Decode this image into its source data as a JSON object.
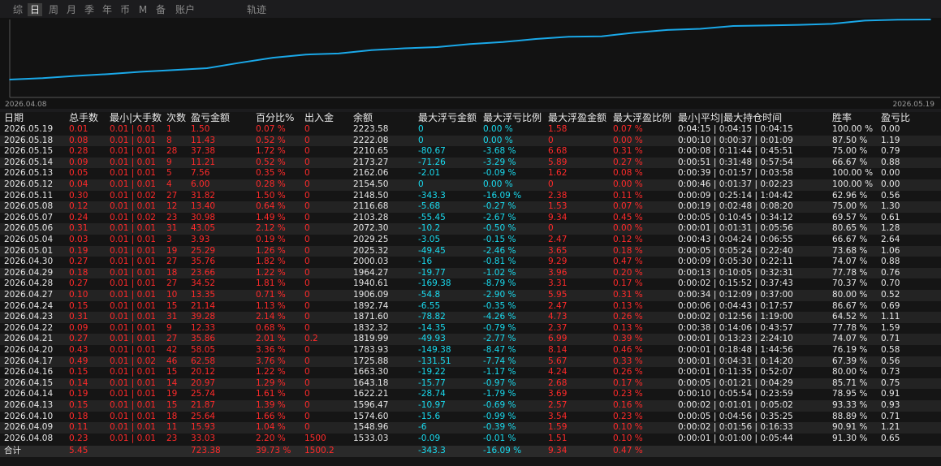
{
  "tabs": [
    {
      "label": "综",
      "active": false
    },
    {
      "label": "日",
      "active": true
    },
    {
      "label": "周",
      "active": false
    },
    {
      "label": "月",
      "active": false
    },
    {
      "label": "季",
      "active": false
    },
    {
      "label": "年",
      "active": false
    },
    {
      "label": "币",
      "active": false
    },
    {
      "label": "M",
      "active": false
    },
    {
      "label": "备",
      "active": false
    },
    {
      "label": "账户",
      "active": false
    },
    {
      "label": "轨迹",
      "active": false
    }
  ],
  "chart_data": {
    "type": "line",
    "x": [
      "2026.04.08",
      "2026.04.09",
      "2026.04.10",
      "2026.04.13",
      "2026.04.14",
      "2026.04.15",
      "2026.04.16",
      "2026.04.17",
      "2026.04.20",
      "2026.04.21",
      "2026.04.22",
      "2026.04.23",
      "2026.04.24",
      "2026.04.27",
      "2026.04.28",
      "2026.04.29",
      "2026.04.30",
      "2026.05.01",
      "2026.05.04",
      "2026.05.06",
      "2026.05.07",
      "2026.05.08",
      "2026.05.11",
      "2026.05.12",
      "2026.05.13",
      "2026.05.14",
      "2026.05.15",
      "2026.05.18",
      "2026.05.19"
    ],
    "series": [
      {
        "values": [
          1533.03,
          1548.96,
          1574.6,
          1596.47,
          1622.21,
          1643.18,
          1663.3,
          1725.88,
          1783.93,
          1819.99,
          1832.32,
          1871.6,
          1892.74,
          1906.09,
          1940.61,
          1964.27,
          2000.03,
          2025.32,
          2029.25,
          2072.3,
          2103.28,
          2116.68,
          2148.5,
          2154.5,
          2162.06,
          2173.27,
          2210.65,
          2222.08,
          2223.58
        ]
      }
    ],
    "x_tick_labels": [
      "2026.04.08",
      "2026.05.19"
    ],
    "line_color": "#1aa8e8",
    "grid": false
  },
  "table": {
    "headers": [
      "日期",
      "总手数",
      "最小|大手数",
      "次数",
      "盈亏金额",
      "百分比%",
      "出入金",
      "余额",
      "最大浮亏金额",
      "最大浮亏比例",
      "最大浮盈金额",
      "最大浮盈比例",
      "最小|平均|最大持仓时间",
      "胜率",
      "盈亏比"
    ],
    "rows": [
      [
        "2026.05.19",
        "0.01",
        "0.01 | 0.01",
        "1",
        "1.50",
        "0.07 %",
        "0",
        "2223.58",
        "0",
        "0.00 %",
        "1.58",
        "0.07 %",
        "0:04:15 | 0:04:15 | 0:04:15",
        "100.00 %",
        "0.00"
      ],
      [
        "2026.05.18",
        "0.08",
        "0.01 | 0.01",
        "8",
        "11.43",
        "0.52 %",
        "0",
        "2222.08",
        "0",
        "0.00 %",
        "0",
        "0.00 %",
        "0:00:10 | 0:00:37 | 0:01:09",
        "87.50 %",
        "1.19"
      ],
      [
        "2026.05.15",
        "0.28",
        "0.01 | 0.01",
        "28",
        "37.38",
        "1.72 %",
        "0",
        "2210.65",
        "-80.67",
        "-3.68 %",
        "6.68",
        "0.31 %",
        "0:00:08 | 0:11:44 | 0:45:51",
        "75.00 %",
        "0.79"
      ],
      [
        "2026.05.14",
        "0.09",
        "0.01 | 0.01",
        "9",
        "11.21",
        "0.52 %",
        "0",
        "2173.27",
        "-71.26",
        "-3.29 %",
        "5.89",
        "0.27 %",
        "0:00:51 | 0:31:48 | 0:57:54",
        "66.67 %",
        "0.88"
      ],
      [
        "2026.05.13",
        "0.05",
        "0.01 | 0.01",
        "5",
        "7.56",
        "0.35 %",
        "0",
        "2162.06",
        "-2.01",
        "-0.09 %",
        "1.62",
        "0.08 %",
        "0:00:39 | 0:01:57 | 0:03:58",
        "100.00 %",
        "0.00"
      ],
      [
        "2026.05.12",
        "0.04",
        "0.01 | 0.01",
        "4",
        "6.00",
        "0.28 %",
        "0",
        "2154.50",
        "0",
        "0.00 %",
        "0",
        "0.00 %",
        "0:00:46 | 0:01:37 | 0:02:23",
        "100.00 %",
        "0.00"
      ],
      [
        "2026.05.11",
        "0.30",
        "0.01 | 0.02",
        "27",
        "31.82",
        "1.50 %",
        "0",
        "2148.50",
        "-343.3",
        "-16.09 %",
        "2.38",
        "0.11 %",
        "0:00:09 | 0:25:14 | 1:04:42",
        "62.96 %",
        "0.56"
      ],
      [
        "2026.05.08",
        "0.12",
        "0.01 | 0.01",
        "12",
        "13.40",
        "0.64 %",
        "0",
        "2116.68",
        "-5.68",
        "-0.27 %",
        "1.53",
        "0.07 %",
        "0:00:19 | 0:02:48 | 0:08:20",
        "75.00 %",
        "1.30"
      ],
      [
        "2026.05.07",
        "0.24",
        "0.01 | 0.02",
        "23",
        "30.98",
        "1.49 %",
        "0",
        "2103.28",
        "-55.45",
        "-2.67 %",
        "9.34",
        "0.45 %",
        "0:00:05 | 0:10:45 | 0:34:12",
        "69.57 %",
        "0.61"
      ],
      [
        "2026.05.06",
        "0.31",
        "0.01 | 0.01",
        "31",
        "43.05",
        "2.12 %",
        "0",
        "2072.30",
        "-10.2",
        "-0.50 %",
        "0",
        "0.00 %",
        "0:00:01 | 0:01:31 | 0:05:56",
        "80.65 %",
        "1.28"
      ],
      [
        "2026.05.04",
        "0.03",
        "0.01 | 0.01",
        "3",
        "3.93",
        "0.19 %",
        "0",
        "2029.25",
        "-3.05",
        "-0.15 %",
        "2.47",
        "0.12 %",
        "0:00:43 | 0:04:24 | 0:06:55",
        "66.67 %",
        "2.64"
      ],
      [
        "2026.05.01",
        "0.19",
        "0.01 | 0.01",
        "19",
        "25.29",
        "1.26 %",
        "0",
        "2025.32",
        "-49.45",
        "-2.46 %",
        "3.65",
        "0.18 %",
        "0:00:05 | 0:05:24 | 0:22:40",
        "73.68 %",
        "1.06"
      ],
      [
        "2026.04.30",
        "0.27",
        "0.01 | 0.01",
        "27",
        "35.76",
        "1.82 %",
        "0",
        "2000.03",
        "-16",
        "-0.81 %",
        "9.29",
        "0.47 %",
        "0:00:09 | 0:05:30 | 0:22:11",
        "74.07 %",
        "0.88"
      ],
      [
        "2026.04.29",
        "0.18",
        "0.01 | 0.01",
        "18",
        "23.66",
        "1.22 %",
        "0",
        "1964.27",
        "-19.77",
        "-1.02 %",
        "3.96",
        "0.20 %",
        "0:00:13 | 0:10:05 | 0:32:31",
        "77.78 %",
        "0.76"
      ],
      [
        "2026.04.28",
        "0.27",
        "0.01 | 0.01",
        "27",
        "34.52",
        "1.81 %",
        "0",
        "1940.61",
        "-169.38",
        "-8.79 %",
        "3.31",
        "0.17 %",
        "0:00:02 | 0:15:52 | 0:37:43",
        "70.37 %",
        "0.70"
      ],
      [
        "2026.04.27",
        "0.10",
        "0.01 | 0.01",
        "10",
        "13.35",
        "0.71 %",
        "0",
        "1906.09",
        "-54.8",
        "-2.90 %",
        "5.95",
        "0.31 %",
        "0:00:34 | 0:12:09 | 0:37:00",
        "80.00 %",
        "0.52"
      ],
      [
        "2026.04.24",
        "0.15",
        "0.01 | 0.01",
        "15",
        "21.14",
        "1.13 %",
        "0",
        "1892.74",
        "-6.55",
        "-0.35 %",
        "2.47",
        "0.13 %",
        "0:00:06 | 0:04:43 | 0:17:57",
        "86.67 %",
        "0.69"
      ],
      [
        "2026.04.23",
        "0.31",
        "0.01 | 0.01",
        "31",
        "39.28",
        "2.14 %",
        "0",
        "1871.60",
        "-78.82",
        "-4.26 %",
        "4.73",
        "0.26 %",
        "0:00:02 | 0:12:56 | 1:19:00",
        "64.52 %",
        "1.11"
      ],
      [
        "2026.04.22",
        "0.09",
        "0.01 | 0.01",
        "9",
        "12.33",
        "0.68 %",
        "0",
        "1832.32",
        "-14.35",
        "-0.79 %",
        "2.37",
        "0.13 %",
        "0:00:38 | 0:14:06 | 0:43:57",
        "77.78 %",
        "1.59"
      ],
      [
        "2026.04.21",
        "0.27",
        "0.01 | 0.01",
        "27",
        "35.86",
        "2.01 %",
        "0.2",
        "1819.99",
        "-49.93",
        "-2.77 %",
        "6.99",
        "0.39 %",
        "0:00:01 | 0:13:23 | 2:24:10",
        "74.07 %",
        "0.71"
      ],
      [
        "2026.04.20",
        "0.43",
        "0.01 | 0.01",
        "42",
        "58.05",
        "3.36 %",
        "0",
        "1783.93",
        "-149.38",
        "-8.47 %",
        "8.14",
        "0.46 %",
        "0:00:01 | 0:18:48 | 1:44:56",
        "76.19 %",
        "0.58"
      ],
      [
        "2026.04.17",
        "0.49",
        "0.01 | 0.02",
        "46",
        "62.58",
        "3.76 %",
        "0",
        "1725.88",
        "-131.51",
        "-7.74 %",
        "5.67",
        "0.33 %",
        "0:00:01 | 0:04:31 | 0:14:20",
        "67.39 %",
        "0.56"
      ],
      [
        "2026.04.16",
        "0.15",
        "0.01 | 0.01",
        "15",
        "20.12",
        "1.22 %",
        "0",
        "1663.30",
        "-19.22",
        "-1.17 %",
        "4.24",
        "0.26 %",
        "0:00:01 | 0:11:35 | 0:52:07",
        "80.00 %",
        "0.73"
      ],
      [
        "2026.04.15",
        "0.14",
        "0.01 | 0.01",
        "14",
        "20.97",
        "1.29 %",
        "0",
        "1643.18",
        "-15.77",
        "-0.97 %",
        "2.68",
        "0.17 %",
        "0:00:05 | 0:01:21 | 0:04:29",
        "85.71 %",
        "0.75"
      ],
      [
        "2026.04.14",
        "0.19",
        "0.01 | 0.01",
        "19",
        "25.74",
        "1.61 %",
        "0",
        "1622.21",
        "-28.74",
        "-1.79 %",
        "3.69",
        "0.23 %",
        "0:00:10 | 0:05:54 | 0:23:59",
        "78.95 %",
        "0.91"
      ],
      [
        "2026.04.13",
        "0.15",
        "0.01 | 0.01",
        "15",
        "21.87",
        "1.39 %",
        "0",
        "1596.47",
        "-10.97",
        "-0.69 %",
        "2.57",
        "0.16 %",
        "0:00:02 | 0:01:01 | 0:05:02",
        "93.33 %",
        "0.93"
      ],
      [
        "2026.04.10",
        "0.18",
        "0.01 | 0.01",
        "18",
        "25.64",
        "1.66 %",
        "0",
        "1574.60",
        "-15.6",
        "-0.99 %",
        "3.54",
        "0.23 %",
        "0:00:05 | 0:04:56 | 0:35:25",
        "88.89 %",
        "0.71"
      ],
      [
        "2026.04.09",
        "0.11",
        "0.01 | 0.01",
        "11",
        "15.93",
        "1.04 %",
        "0",
        "1548.96",
        "-6",
        "-0.39 %",
        "1.59",
        "0.10 %",
        "0:00:02 | 0:01:56 | 0:16:33",
        "90.91 %",
        "1.21"
      ],
      [
        "2026.04.08",
        "0.23",
        "0.01 | 0.01",
        "23",
        "33.03",
        "2.20 %",
        "1500",
        "1533.03",
        "-0.09",
        "-0.01 %",
        "1.51",
        "0.10 %",
        "0:00:01 | 0:01:00 | 0:05:44",
        "91.30 %",
        "0.65"
      ]
    ],
    "total": [
      "合计",
      "5.45",
      "",
      "",
      "723.38",
      "39.73 %",
      "1500.2",
      "",
      "-343.3",
      "-16.09 %",
      "9.34",
      "0.47 %",
      "",
      "",
      ""
    ]
  },
  "colors": {
    "positive": "#ff2a2a",
    "negative": "#19dcf0",
    "neutral": "#e6e6e6",
    "line": "#1aa8e8"
  }
}
